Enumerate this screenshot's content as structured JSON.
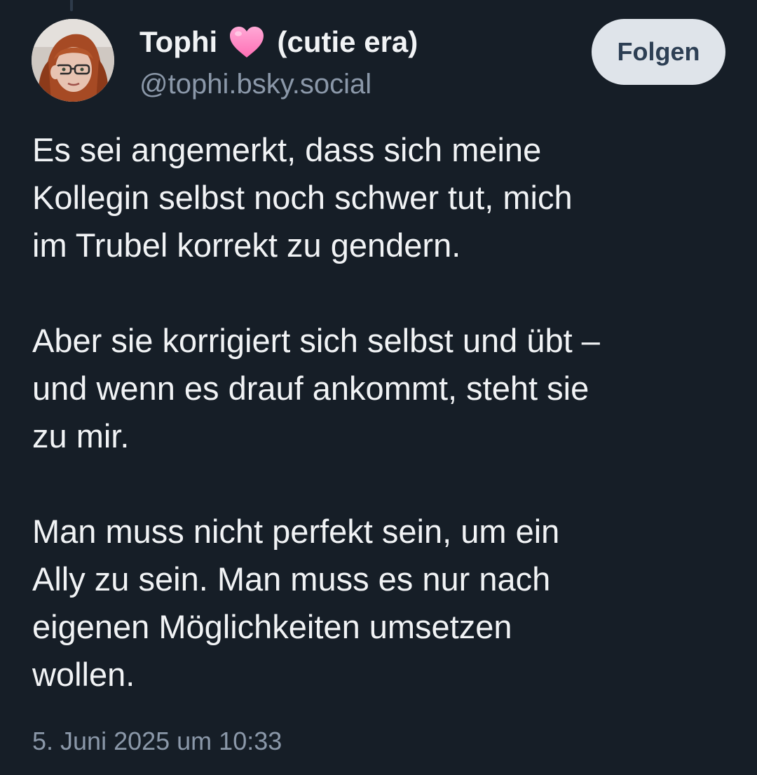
{
  "author": {
    "display_name_prefix": "Tophi",
    "display_name_suffix": "(cutie era)",
    "heart_icon": "pink-heart-emoji",
    "handle": "@tophi.bsky.social",
    "avatar_icon": "user-avatar-photo"
  },
  "follow_button": {
    "label": "Folgen"
  },
  "post": {
    "paragraphs": [
      "Es sei angemerkt, dass sich meine\nKollegin selbst noch schwer tut, mich\nim Trubel korrekt zu gendern.",
      "Aber sie korrigiert sich selbst und übt –\nund wenn es drauf ankommt, steht sie\nzu mir.",
      "Man muss nicht perfekt sein, um ein\nAlly zu sein. Man muss es nur nach\neigenen Möglichkeiten umsetzen\nwollen."
    ],
    "timestamp": "5. Juni 2025 um 10:33"
  },
  "colors": {
    "background": "#161e27",
    "text": "#f1f3f5",
    "muted": "#8b98a9",
    "button_bg": "#dfe4ea",
    "button_text": "#2d3f54",
    "heart": "#ff8fc8"
  }
}
